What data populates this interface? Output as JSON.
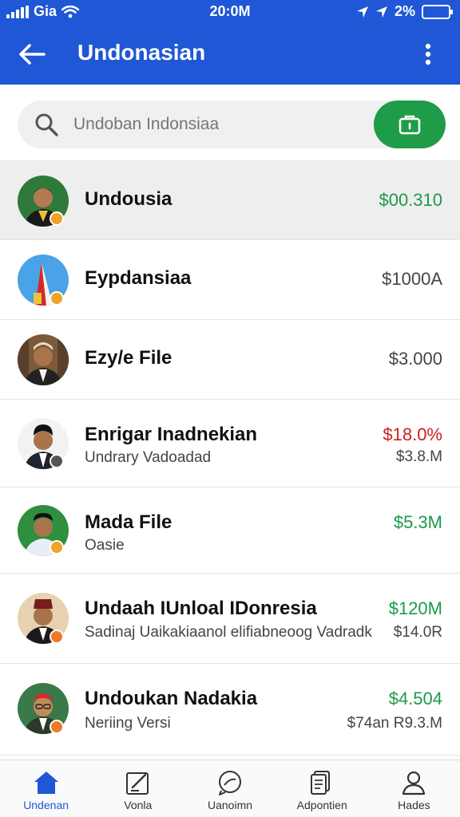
{
  "status_bar": {
    "carrier": "Gia",
    "time": "20:0M",
    "battery": "2%"
  },
  "header": {
    "title": "Undonasian"
  },
  "search": {
    "placeholder": "Undoban Indonsiaa"
  },
  "colors": {
    "primary": "#1f57d6",
    "accent_green": "#1b9a4a",
    "negative_red": "#cc1f1f"
  },
  "list": [
    {
      "name": "Undousia",
      "subtitle": "",
      "value": "$00.310",
      "value_color": "green",
      "secondary": ""
    },
    {
      "name": "Eypdansiaa",
      "subtitle": "",
      "value": "$1000A",
      "value_color": "grey",
      "secondary": ""
    },
    {
      "name": "Ezy/e File",
      "subtitle": "",
      "value": "$3.000",
      "value_color": "grey",
      "secondary": ""
    },
    {
      "name": "Enrigar Inadnekian",
      "subtitle": "Undrary Vadoadad",
      "value": "$18.0%",
      "value_color": "red",
      "secondary": "$3.8.M"
    },
    {
      "name": "Mada File",
      "subtitle": "Oasie",
      "value": "$5.3M",
      "value_color": "green",
      "secondary": ""
    },
    {
      "name": "Undaah IUnloal IDonresia",
      "subtitle": "Sadinaj Uaikakiaanol elifiabneoog Vadradk",
      "value": "$120M",
      "value_color": "green",
      "secondary": "$14.0R"
    },
    {
      "name": "Undoukan Nadakia",
      "subtitle": "Neriing Versi",
      "value": "$4.504",
      "value_color": "green",
      "secondary": "$74an R9.3.M"
    }
  ],
  "bottom_nav": [
    {
      "label": "Undenan",
      "icon": "home-icon"
    },
    {
      "label": "Vonla",
      "icon": "edit-icon"
    },
    {
      "label": "Uanoimn",
      "icon": "chat-icon"
    },
    {
      "label": "Adpontien",
      "icon": "document-icon"
    },
    {
      "label": "Hades",
      "icon": "profile-icon"
    }
  ]
}
